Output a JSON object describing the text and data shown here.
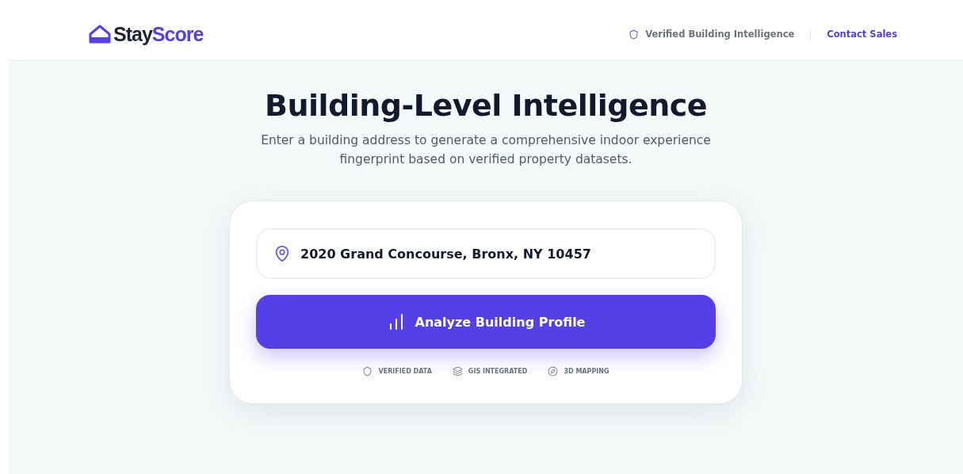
{
  "header": {
    "logo": {
      "first": "Stay",
      "second": "Score"
    },
    "badge": "Verified Building Intelligence",
    "link": "Contact Sales"
  },
  "hero": {
    "title": "Building-Level Intelligence",
    "subtitle": "Enter a building address to generate a comprehensive indoor experience fingerprint based on verified property datasets."
  },
  "search": {
    "value": "2020 Grand Concourse, Bronx, NY 10457",
    "button": "Analyze Building Profile"
  },
  "features": [
    {
      "kind": "shield",
      "label": "VERIFIED DATA"
    },
    {
      "kind": "layers",
      "label": "GIS INTEGRATED"
    },
    {
      "kind": "compass",
      "label": "3D MAPPING"
    }
  ]
}
